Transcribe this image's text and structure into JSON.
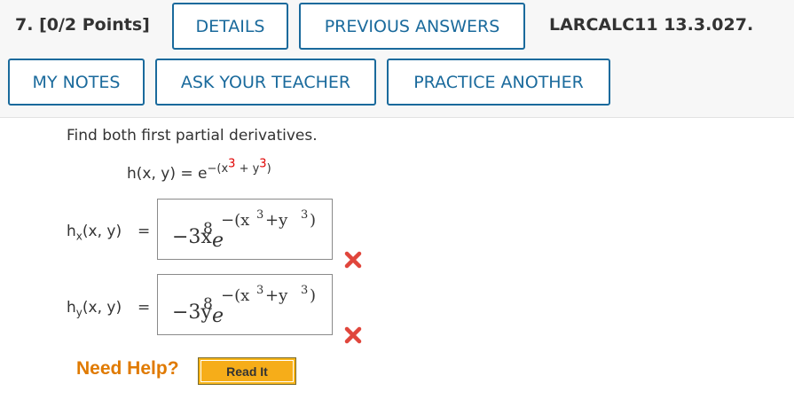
{
  "question": {
    "number_label": "7.",
    "points_label": "[0/2 Points]",
    "id": "LARCALC11 13.3.027."
  },
  "buttons": {
    "details": "DETAILS",
    "previous_answers": "PREVIOUS ANSWERS",
    "my_notes": "MY NOTES",
    "ask_teacher": "ASK YOUR TEACHER",
    "practice_another": "PRACTICE ANOTHER"
  },
  "problem": {
    "instruction": "Find both first partial derivatives.",
    "function_lhs": "h(x, y) = e",
    "exponent_prefix": "−(x",
    "exponent_power1": "3",
    "exponent_mid": " + y",
    "exponent_power2": "3",
    "exponent_suffix": ")"
  },
  "answers": [
    {
      "label_main": "h",
      "label_sub": "x",
      "label_rest": "(x, y)",
      "equals": "=",
      "coef": "−3x",
      "coef_power": "8",
      "base": "e",
      "exp_open": "−(x",
      "exp_p1": "3",
      "exp_plus": "+y",
      "exp_p2": "3",
      "exp_close": ")",
      "status": "incorrect"
    },
    {
      "label_main": "h",
      "label_sub": "y",
      "label_rest": "(x, y)",
      "equals": "=",
      "coef": "−3y",
      "coef_power": "8",
      "base": "e",
      "exp_open": "−(x",
      "exp_p1": "3",
      "exp_plus": "+y",
      "exp_p2": "3",
      "exp_close": ")",
      "status": "incorrect"
    }
  ],
  "help": {
    "need_help": "Need Help?",
    "read_it": "Read It"
  },
  "colors": {
    "accent": "#1a6a9c",
    "incorrect": "#e0463c",
    "highlight_red": "#e00000",
    "help_orange": "#e07a00",
    "read_it_bg": "#f6ad19"
  },
  "icons": {
    "incorrect_mark": "x-mark-icon"
  }
}
